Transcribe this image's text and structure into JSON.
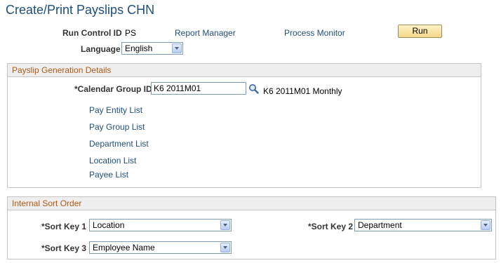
{
  "page": {
    "title": "Create/Print Payslips CHN"
  },
  "run_control": {
    "label": "Run Control ID",
    "value": "PS",
    "report_manager": "Report Manager",
    "process_monitor": "Process Monitor",
    "run_button": "Run"
  },
  "language": {
    "label": "Language",
    "value": "English"
  },
  "payslip_details": {
    "title": "Payslip Generation Details",
    "calendar_group_label": "*Calendar Group ID",
    "calendar_group_value": "K6 2011M01",
    "calendar_group_desc": "K6 2011M01 Monthly",
    "links": [
      "Pay Entity List",
      "Pay Group List",
      "Department List",
      "Location List",
      "Payee List"
    ]
  },
  "sort_order": {
    "title": "Internal Sort Order",
    "key1_label": "*Sort Key 1",
    "key1_value": "Location",
    "key2_label": "*Sort Key 2",
    "key2_value": "Department",
    "key3_label": "*Sort Key 3",
    "key3_value": "Employee Name"
  },
  "colors": {
    "title": "#1f4e7a",
    "link": "#1f4e7a",
    "group_title": "#b05a15",
    "group_header_bg": "#eeeeee"
  },
  "icons": {
    "lookup": "magnifier-icon",
    "dropdown": "chevron-down-icon"
  }
}
